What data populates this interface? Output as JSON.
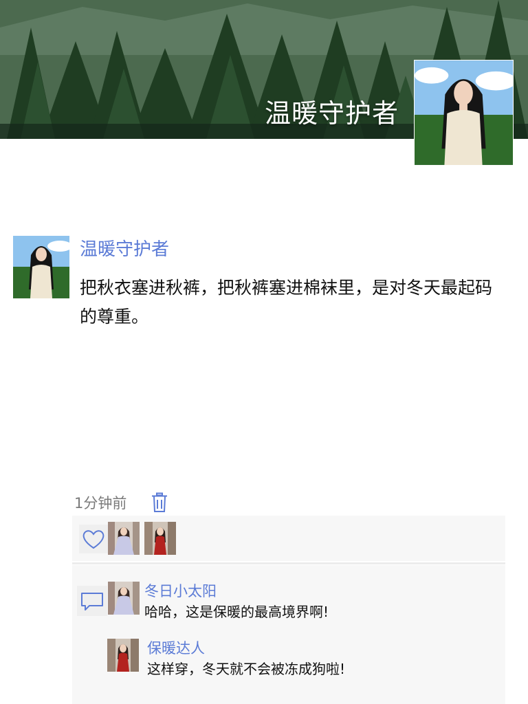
{
  "profile": {
    "name": "温暖守护者"
  },
  "post": {
    "author": "温暖守护者",
    "content": "把秋衣塞进秋裤，把秋裤塞进棉袜里，是对冬天最起码的尊重。",
    "time": "1分钟前"
  },
  "likes": {
    "icon": "heart-icon",
    "users": [
      "like-avatar-1",
      "like-avatar-2"
    ]
  },
  "comments": [
    {
      "author": "冬日小太阳",
      "text": "哈哈，这是保暖的最高境界啊!"
    },
    {
      "author": "保暖达人",
      "text": "这样穿，冬天就不会被冻成狗啦!"
    }
  ],
  "colors": {
    "accent": "#5b7bd6",
    "panel": "#f7f7f7",
    "text": "#111111",
    "meta": "#7a7a7a"
  }
}
